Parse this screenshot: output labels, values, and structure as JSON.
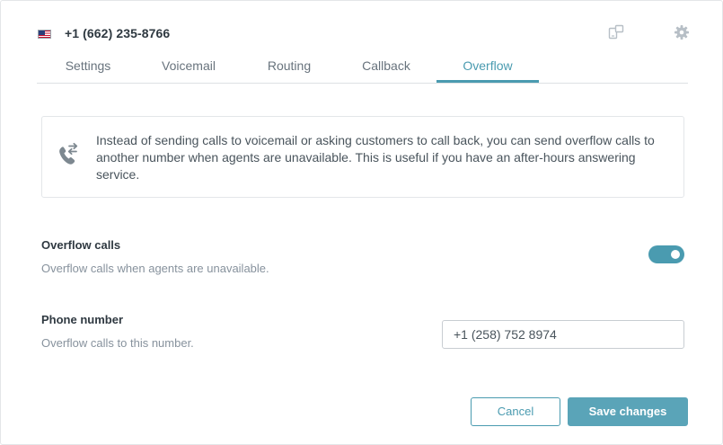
{
  "header": {
    "phone_number": "+1 (662) 235-8766",
    "flag_icon": "us-flag-icon",
    "popout_icon": "popout-icon",
    "settings_icon": "gear-icon"
  },
  "tabs": [
    {
      "label": "Settings",
      "active": false
    },
    {
      "label": "Voicemail",
      "active": false
    },
    {
      "label": "Routing",
      "active": false
    },
    {
      "label": "Callback",
      "active": false
    },
    {
      "label": "Overflow",
      "active": true
    }
  ],
  "info": {
    "icon": "call-transfer-icon",
    "text": "Instead of sending calls to voicemail or asking customers to call back, you can send overflow calls to another number when agents are unavailable. This is useful if you have an after-hours answering service."
  },
  "overflow_calls": {
    "title": "Overflow calls",
    "description": "Overflow calls when agents are unavailable.",
    "enabled": true
  },
  "phone_number_setting": {
    "title": "Phone number",
    "description": "Overflow calls to this number.",
    "value": "+1 (258) 752 8974"
  },
  "buttons": {
    "cancel_label": "Cancel",
    "save_label": "Save changes"
  },
  "colors": {
    "accent": "#4a9bb0",
    "save_button": "#5aa4b8",
    "text_primary": "#2f3941",
    "text_secondary": "#87929d"
  }
}
